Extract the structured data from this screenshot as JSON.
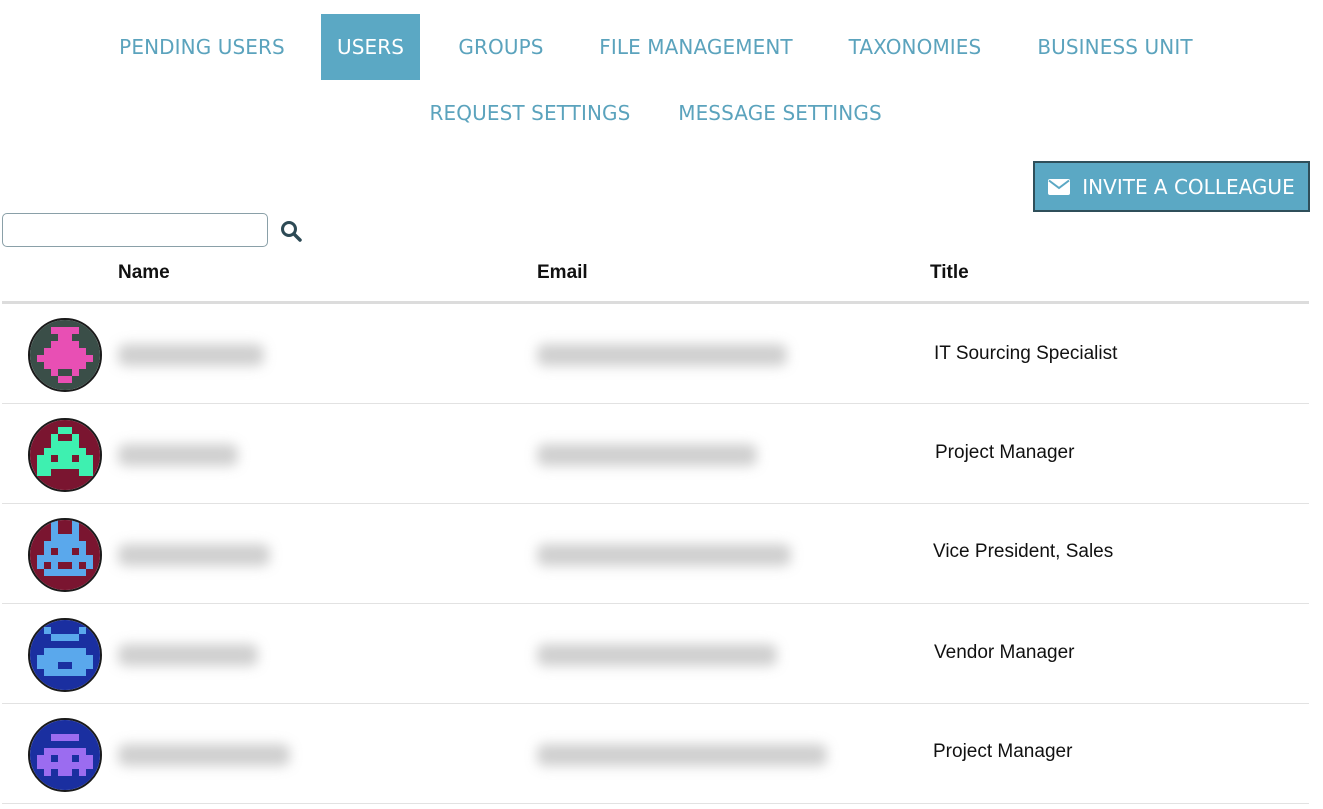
{
  "tabs": [
    {
      "label": "PENDING USERS",
      "active": false
    },
    {
      "label": "USERS",
      "active": true
    },
    {
      "label": "GROUPS",
      "active": false
    },
    {
      "label": "FILE MANAGEMENT",
      "active": false
    },
    {
      "label": "TAXONOMIES",
      "active": false
    },
    {
      "label": "BUSINESS UNIT",
      "active": false
    },
    {
      "label": "REQUEST SETTINGS",
      "active": false
    },
    {
      "label": "MESSAGE SETTINGS",
      "active": false
    }
  ],
  "invite": {
    "label": "INVITE A COLLEAGUE",
    "icon": "envelope-icon"
  },
  "search": {
    "value": "",
    "placeholder": "",
    "icon": "search-icon"
  },
  "table": {
    "headers": {
      "name": "Name",
      "email": "Email",
      "title": "Title"
    },
    "rows": [
      {
        "title": "IT Sourcing Specialist",
        "avatar_bg": "#3a4e48",
        "avatar_fg": "#e84fb4"
      },
      {
        "title": "Project Manager",
        "avatar_bg": "#7a1530",
        "avatar_fg": "#3ef0b0"
      },
      {
        "title": "Vice President, Sales",
        "avatar_bg": "#7a1530",
        "avatar_fg": "#5aa8ec"
      },
      {
        "title": "Vendor Manager",
        "avatar_bg": "#1a2fa0",
        "avatar_fg": "#5aa8ec"
      },
      {
        "title": "Project Manager",
        "avatar_bg": "#1a2fa0",
        "avatar_fg": "#9b6cf0"
      }
    ]
  },
  "colors": {
    "accent": "#5ba8c4",
    "tab_text": "#5ba3bd"
  }
}
